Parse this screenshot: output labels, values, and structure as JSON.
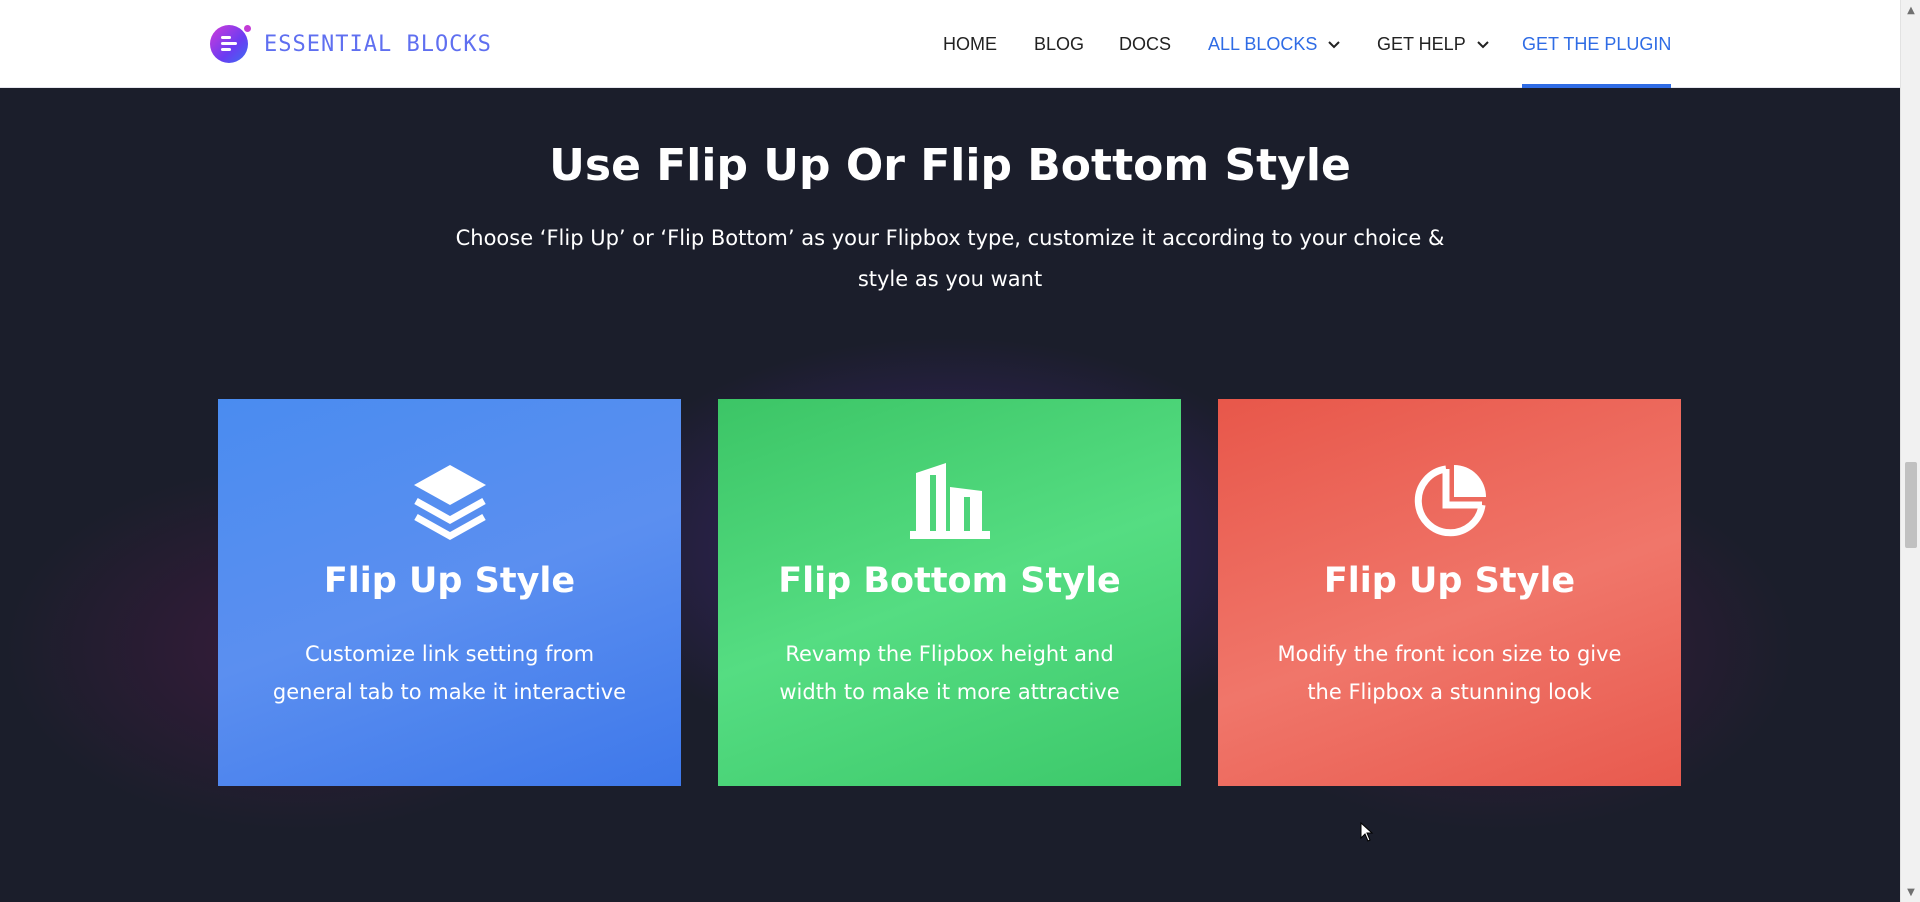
{
  "header": {
    "logo_text": "ESSENTIAL BLOCKS",
    "nav": [
      {
        "label": "HOME"
      },
      {
        "label": "BLOG"
      },
      {
        "label": "DOCS"
      },
      {
        "label": "ALL BLOCKS"
      },
      {
        "label": "GET HELP"
      },
      {
        "label": "GET THE PLUGIN"
      }
    ]
  },
  "main": {
    "title": "Use Flip Up Or Flip Bottom Style",
    "subtitle_line1": "Choose ‘Flip Up’ or ‘Flip Bottom’ as your Flipbox type, customize it according to your choice &",
    "subtitle_line2": "style as you want",
    "cards": [
      {
        "icon": "layers-icon",
        "title": "Flip Up Style",
        "desc_line1": "Customize link setting from",
        "desc_line2": "general tab to make it interactive",
        "color": "#4a8cf0"
      },
      {
        "icon": "buildings-icon",
        "title": "Flip Bottom Style",
        "desc_line1": "Revamp the Flipbox height and",
        "desc_line2": "width to make it more attractive",
        "color": "#4ed47a"
      },
      {
        "icon": "pie-chart-icon",
        "title": "Flip Up Style",
        "desc_line1": "Modify the front icon size to give",
        "desc_line2": "the Flipbox a stunning look",
        "color": "#ec6559"
      }
    ]
  },
  "colors": {
    "accent": "#2f6ce5",
    "background": "#1b1e2b"
  }
}
